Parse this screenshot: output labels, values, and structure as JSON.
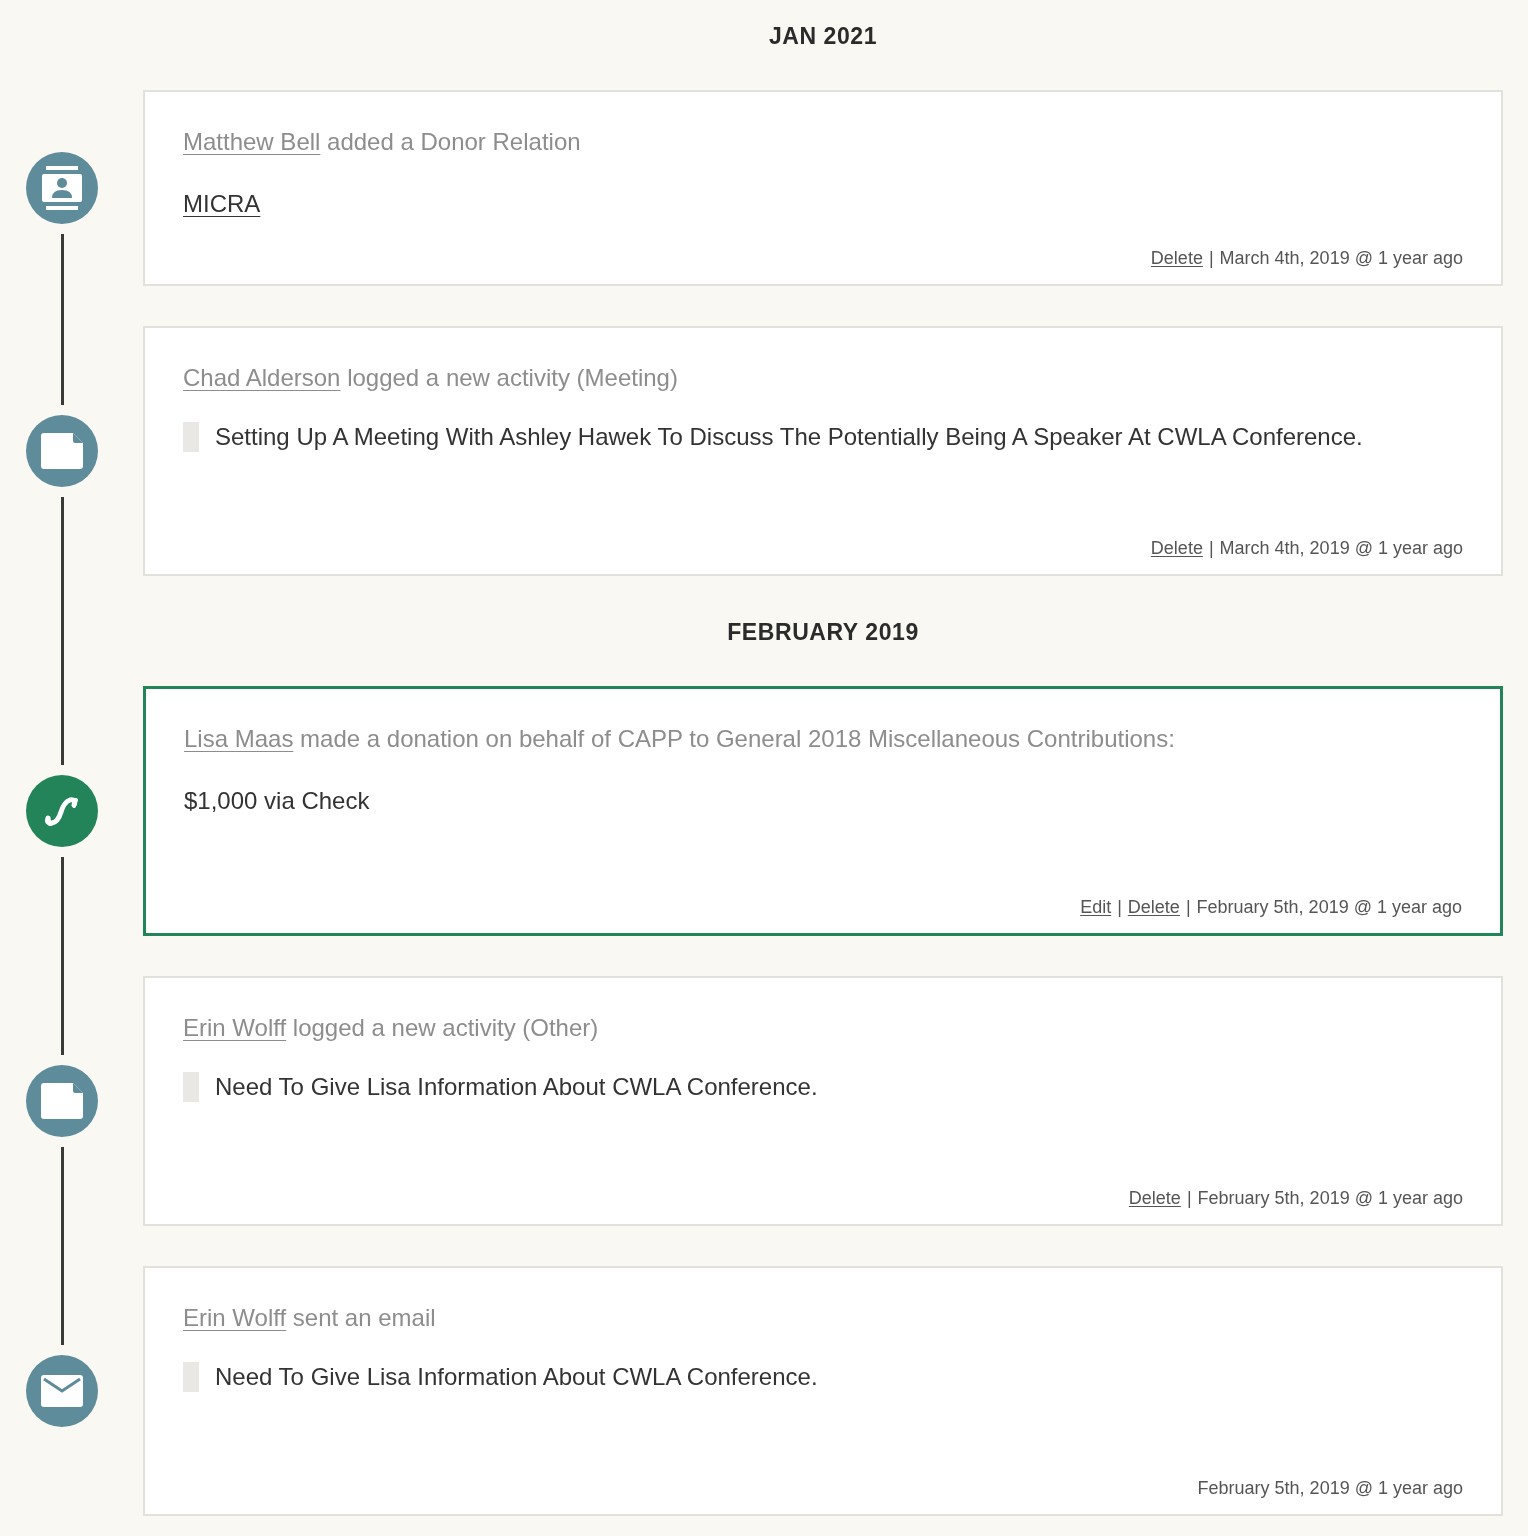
{
  "separator": "|",
  "items": [
    {
      "kind": "heading",
      "text": "JAN 2021"
    },
    {
      "kind": "relation",
      "selected": false,
      "actor": "Matthew Bell",
      "action": "added a Donor Relation",
      "body": "MICRA",
      "actions": [
        "Delete"
      ],
      "date": "March 4th, 2019 @ 1 year ago"
    },
    {
      "kind": "activity",
      "selected": false,
      "actor": "Chad Alderson",
      "action": "logged a new activity (Meeting)",
      "body": "Setting Up A Meeting With Ashley Hawek To Discuss The Potentially Being A Speaker At CWLA Conference.",
      "actions": [
        "Delete"
      ],
      "date": "March 4th, 2019 @ 1 year ago"
    },
    {
      "kind": "heading",
      "text": "FEBRUARY 2019"
    },
    {
      "kind": "donation",
      "selected": true,
      "actor": "Lisa Maas",
      "action": "made a donation on behalf of CAPP to General 2018 Miscellaneous Contributions:",
      "body": "$1,000 via Check",
      "actions": [
        "Edit",
        "Delete"
      ],
      "date": "February 5th, 2019 @ 1 year ago"
    },
    {
      "kind": "activity",
      "selected": false,
      "actor": "Erin Wolff",
      "action": "logged a new activity (Other)",
      "body": "Need To Give Lisa Information About CWLA Conference.",
      "actions": [
        "Delete"
      ],
      "date": "February 5th, 2019 @ 1 year ago"
    },
    {
      "kind": "email",
      "selected": false,
      "actor": "Erin Wolff",
      "action": "sent an email",
      "body": "Need To Give Lisa Information About CWLA Conference.",
      "date": "February 5th, 2019 @ 1 year ago"
    }
  ]
}
